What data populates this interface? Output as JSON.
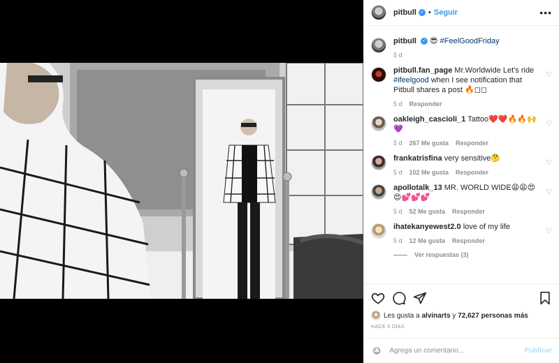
{
  "post": {
    "username": "pitbull",
    "follow_label": "Seguir",
    "separator": "•",
    "more_label": "•••",
    "caption_emoji": "😎",
    "caption_tag": "#FeelGoodFriday",
    "caption_time": "5 d"
  },
  "comments": [
    {
      "username": "pitbull.fan_page",
      "text_pre": "Mr.Worldwide Let's ride ",
      "tag": "#ifeelgood",
      "text_post": " when I see notification that Pitbull shares a post 🔥◻◻",
      "time": "5 d",
      "likes": "",
      "reply": "Responder"
    },
    {
      "username": "oakleigh_cascioli_1",
      "text_pre": "Tattoo❤️❤️🔥🔥🙌💜",
      "tag": "",
      "text_post": "",
      "time": "5 d",
      "likes": "267 Me gusta",
      "reply": "Responder"
    },
    {
      "username": "frankatrisfina",
      "text_pre": "very sensitive🤔",
      "tag": "",
      "text_post": "",
      "time": "5 d",
      "likes": "102 Me gusta",
      "reply": "Responder"
    },
    {
      "username": "apollotalk_13",
      "text_pre": "MR. WORLD WIDE😩😩😍😍💕💕💕",
      "tag": "",
      "text_post": "",
      "time": "5 d",
      "likes": "52 Me gusta",
      "reply": "Responder"
    },
    {
      "username": "ihatekanyewest2.0",
      "text_pre": "love of my life",
      "tag": "",
      "text_post": "",
      "time": "5 d",
      "likes": "12 Me gusta",
      "reply": "Responder"
    }
  ],
  "view_replies": "Ver respuestas (3)",
  "likes_line": {
    "prefix": "Les gusta a ",
    "user": "alvinarts",
    "middle": " y ",
    "count": "72,627 personas más"
  },
  "time_ago": "HACE 5 DÍAS",
  "comment_box": {
    "placeholder": "Agrega un comentario...",
    "publish": "Publicar"
  },
  "icons": {
    "emoji": "☺",
    "heart_small": "♡"
  },
  "colors": {
    "link": "#3897f0",
    "text": "#262626",
    "muted": "#8e8e8e",
    "publish_disabled": "#b2dffc"
  }
}
